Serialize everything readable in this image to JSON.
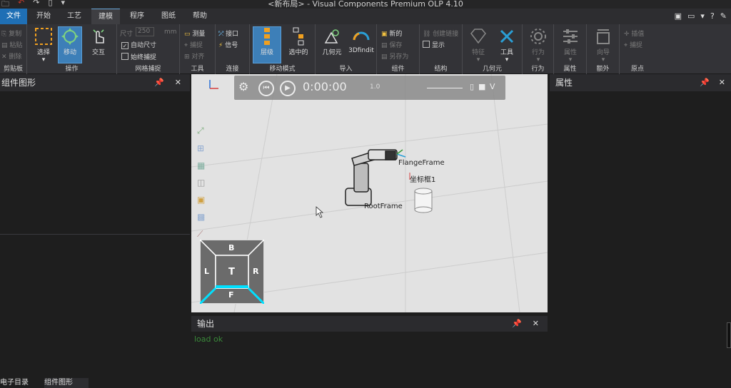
{
  "window": {
    "title": "<新布局> - Visual Components Premium OLP 4.10"
  },
  "tabs": [
    {
      "label": "文件"
    },
    {
      "label": "开始"
    },
    {
      "label": "工艺"
    },
    {
      "label": "建模"
    },
    {
      "label": "程序"
    },
    {
      "label": "图纸"
    },
    {
      "label": "帮助"
    }
  ],
  "ribbon": {
    "clipboard": {
      "label": "剪贴板",
      "copy": "复制",
      "paste": "粘贴",
      "delete": "删除"
    },
    "operation": {
      "label": "操作",
      "select": "选择",
      "move": "移动",
      "interact": "交互"
    },
    "snap": {
      "label": "网格捕捉",
      "size_label": "尺寸",
      "size_value": "250",
      "size_unit": "mm",
      "auto_size": "自动尺寸",
      "always_snap": "始终捕捉"
    },
    "tools": {
      "label": "工具",
      "measure": "测量",
      "snap": "捕捉",
      "align": "对齐"
    },
    "connect": {
      "label": "连接",
      "port": "接口",
      "signal": "信号"
    },
    "move_mode": {
      "label": "移动模式",
      "layer": "层级",
      "selected": "选中的"
    },
    "import": {
      "label": "导入",
      "geometry": "几何元",
      "findit": "3Dfindit"
    },
    "component": {
      "label": "组件",
      "new": "新的",
      "save": "保存",
      "save_as": "另存为"
    },
    "structure": {
      "label": "结构",
      "create_link": "创建链接",
      "show": "显示"
    },
    "geometry": {
      "label": "几何元",
      "feature": "特征",
      "tools": "工具"
    },
    "behavior": {
      "label": "行为",
      "behavior": "行为"
    },
    "properties": {
      "label": "属性",
      "properties": "属性"
    },
    "extra": {
      "label": "额外",
      "wizard": "向导"
    },
    "origin": {
      "label": "原点",
      "insert": "插值",
      "snap": "捕捉"
    }
  },
  "panels": {
    "left_title": "组件图形",
    "right_title": "属性",
    "output_title": "输出",
    "output_text": "load ok",
    "bottom_tabs": [
      "电子目录",
      "组件图形"
    ]
  },
  "viewport": {
    "time": "0:00:00",
    "speed": "1.0",
    "labels": {
      "flange": "FlangeFrame",
      "coord": "坐标框1",
      "root": "RootFrame"
    },
    "cube": {
      "back": "B",
      "left": "L",
      "top": "T",
      "right": "R",
      "front": "F"
    }
  },
  "colors": {
    "accent": "#3d7fb8",
    "file_tab": "#1f6fb5",
    "highlight": "#00bcd4"
  }
}
